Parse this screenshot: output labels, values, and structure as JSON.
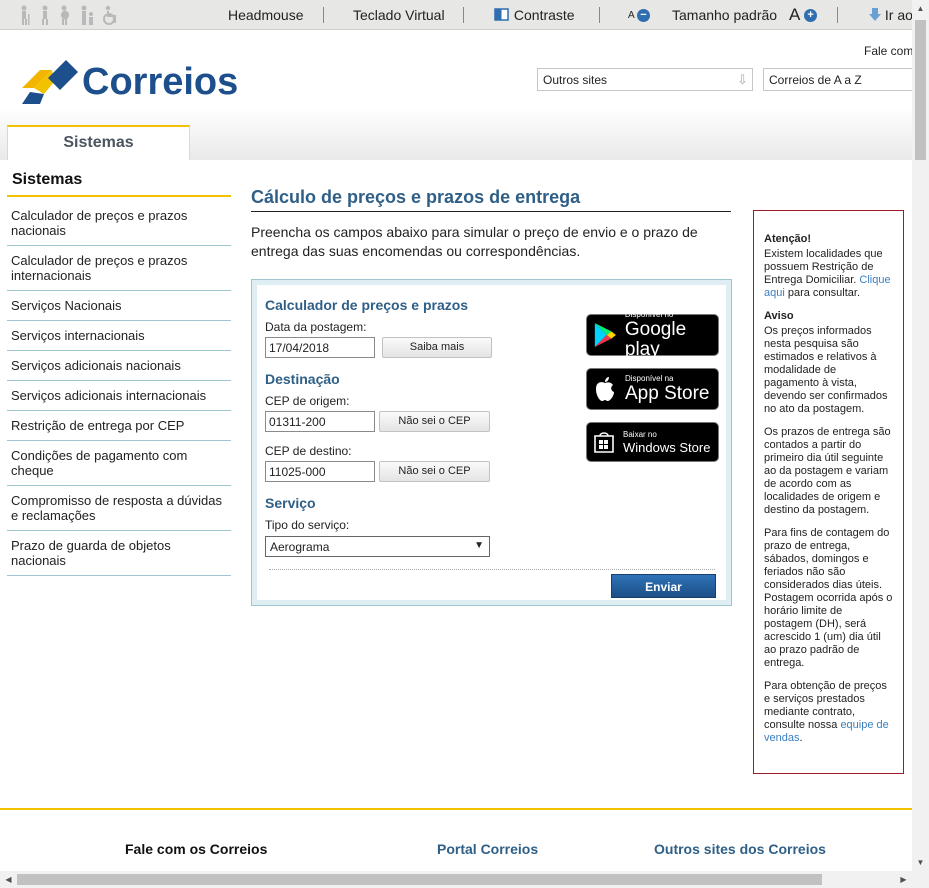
{
  "accessibility": {
    "headmouse": "Headmouse",
    "teclado": "Teclado Virtual",
    "contraste": "Contraste",
    "a_small": "A",
    "tamanho": "Tamanho padrão",
    "a_large": "A",
    "ir": "Ir ao"
  },
  "header": {
    "logo_text": "Correios",
    "fale_com": "Fale com",
    "outros_sites": "Outros sites",
    "correios_az": "Correios de A a Z",
    "tab": "Sistemas"
  },
  "sidebar": {
    "title": "Sistemas",
    "items": [
      {
        "label": "Calculador de preços e prazos nacionais"
      },
      {
        "label": "Calculador de preços e prazos internacionais"
      },
      {
        "label": "Serviços Nacionais"
      },
      {
        "label": "Serviços internacionais"
      },
      {
        "label": "Serviços adicionais nacionais"
      },
      {
        "label": "Serviços adicionais internacionais"
      },
      {
        "label": "Restrição de entrega por CEP"
      },
      {
        "label": "Condições de pagamento com cheque"
      },
      {
        "label": "Compromisso de resposta a dúvidas e reclamações"
      },
      {
        "label": "Prazo de guarda de objetos nacionais"
      }
    ]
  },
  "main": {
    "title": "Cálculo de preços e prazos de entrega",
    "intro": "Preencha os campos abaixo para simular o preço de envio e o prazo de entrega das suas encomendas ou correspondências."
  },
  "form": {
    "calc_heading": "Calculador de preços e prazos",
    "date_label": "Data da postagem:",
    "date_value": "17/04/2018",
    "saiba_mais": "Saiba mais",
    "destino_heading": "Destinação",
    "origem_label": "CEP de origem:",
    "origem_value": "01311-200",
    "nao_sei": "Não sei o CEP",
    "destino_label": "CEP de destino:",
    "destino_value": "11025-000",
    "servico_heading": "Serviço",
    "tipo_label": "Tipo do serviço:",
    "tipo_value": "Aerograma",
    "enviar": "Enviar"
  },
  "stores": {
    "google_small": "Disponível no",
    "google_big": "Google play",
    "apple_small": "Disponível na",
    "apple_big": "App Store",
    "windows_small": "Baixar no",
    "windows_big": "Windows Store"
  },
  "notice": {
    "atencao_title": "Atenção!",
    "atencao_text": "Existem localidades que possuem Restrição de Entrega Domiciliar.",
    "clique": "Clique aqui",
    "para_consultar": " para consultar.",
    "aviso_title": "Aviso",
    "aviso_text": "Os preços informados nesta pesquisa são estimados e relativos à modalidade de pagamento à vista, devendo ser confirmados no ato da postagem.",
    "p3": "Os prazos de entrega são contados a partir do primeiro dia útil seguinte ao da postagem e variam de acordo com as localidades de origem e destino da postagem.",
    "p4": "Para fins de contagem do prazo de entrega, sábados, domingos e feriados não são considerados dias úteis. Postagem ocorrida após o horário limite de postagem (DH), será acrescido 1 (um) dia útil ao prazo padrão de entrega.",
    "p5_pre": "Para obtenção de preços e serviços prestados mediante contrato, consulte nossa ",
    "p5_link": "equipe de vendas",
    "p5_post": "."
  },
  "footer": {
    "fale": "Fale com os Correios",
    "portal": "Portal Correios",
    "outros": "Outros sites dos Correios"
  },
  "colors": {
    "brand_blue": "#1d4f8c",
    "brand_yellow": "#f2c200",
    "heading_blue": "#2f5f86",
    "notice_border": "#9c1c2a"
  }
}
